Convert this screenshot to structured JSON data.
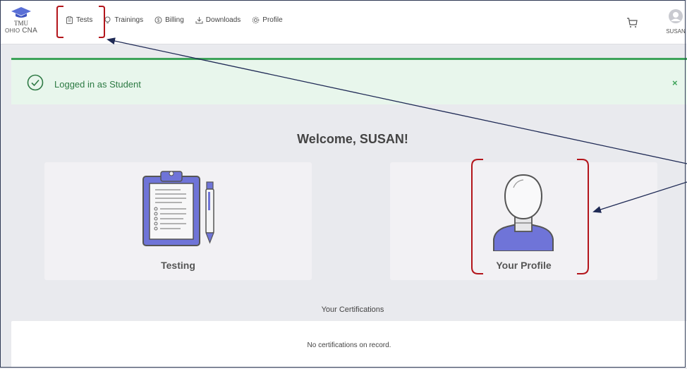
{
  "logo": {
    "line1": "TMU",
    "line2_small": "OHIO",
    "line2": "CNA"
  },
  "nav": [
    {
      "label": "Tests",
      "icon": "clipboard-icon"
    },
    {
      "label": "Trainings",
      "icon": "lightbulb-icon"
    },
    {
      "label": "Billing",
      "icon": "dollar-icon"
    },
    {
      "label": "Downloads",
      "icon": "download-icon"
    },
    {
      "label": "Profile",
      "icon": "gear-icon"
    }
  ],
  "header": {
    "cart_icon": "cart-icon",
    "user_name": "SUSAN"
  },
  "alert": {
    "message": "Logged in as Student",
    "close": "×",
    "color": "#3ea35a"
  },
  "main": {
    "welcome": "Welcome, SUSAN!",
    "cards": [
      {
        "label": "Testing",
        "icon": "clipboard-pen-icon"
      },
      {
        "label": "Your Profile",
        "icon": "user-profile-icon"
      }
    ]
  },
  "certifications": {
    "title": "Your Certifications",
    "empty": "No certifications on record."
  },
  "colors": {
    "accent": "#6f74d8",
    "annotation": "#b3151b",
    "arrow": "#1f2a55"
  }
}
